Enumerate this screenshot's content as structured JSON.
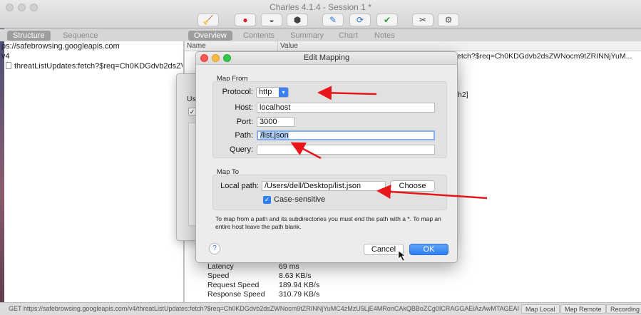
{
  "window": {
    "title": "Charles 4.1.4 - Session 1 *"
  },
  "toolbar": {
    "buttons": [
      {
        "name": "broom-icon",
        "glyph": "🧹",
        "color": "#d9a400"
      },
      {
        "name": "record-icon",
        "glyph": "●",
        "color": "#d0202a"
      },
      {
        "name": "throttle-icon",
        "glyph": "◒",
        "color": "#555555"
      },
      {
        "name": "breakpoint-icon",
        "glyph": "⬢",
        "color": "#444444"
      },
      {
        "name": "compose-icon",
        "glyph": "✎",
        "color": "#2f6fd6"
      },
      {
        "name": "repeat-icon",
        "glyph": "⟳",
        "color": "#2f6fd6"
      },
      {
        "name": "validate-icon",
        "glyph": "✔",
        "color": "#1e9e3a"
      },
      {
        "name": "tools-icon",
        "glyph": "✂",
        "color": "#444444"
      },
      {
        "name": "settings-icon",
        "glyph": "⚙",
        "color": "#555555"
      }
    ]
  },
  "left_tabs": {
    "structure": "Structure",
    "sequence": "Sequence"
  },
  "right_tabs": {
    "overview": "Overview",
    "contents": "Contents",
    "summary": "Summary",
    "chart": "Chart",
    "notes": "Notes"
  },
  "tree": {
    "items": [
      "ps://safebrowsing.googleapis.com",
      "v4",
      "threatListUpdates:fetch?$req=Ch0KDGdvb2dsZWNo"
    ]
  },
  "overview": {
    "col_name": "Name",
    "col_value": "Value",
    "url_value": "etch?$req=Ch0KDGdvb2dsZWNocm9tZRINNjYuM...",
    "fragment_h2": "h2]",
    "bg_fragment_us": "Us",
    "rows": [
      {
        "name": "Latency",
        "value": "69 ms"
      },
      {
        "name": "Speed",
        "value": "8.63 KB/s"
      },
      {
        "name": "Request Speed",
        "value": "189.94 KB/s"
      },
      {
        "name": "Response Speed",
        "value": "310.79 KB/s"
      }
    ]
  },
  "dialog": {
    "title": "Edit Mapping",
    "map_from_label": "Map From",
    "protocol_label": "Protocol:",
    "protocol_value": "http",
    "host_label": "Host:",
    "host_value": "localhost",
    "port_label": "Port:",
    "port_value": "3000",
    "path_label": "Path:",
    "path_value": "/list.json",
    "query_label": "Query:",
    "query_value": "",
    "map_to_label": "Map To",
    "local_path_label": "Local path:",
    "local_path_value": "/Users/dell/Desktop/list.json",
    "choose_label": "Choose",
    "case_sensitive_label": "Case-sensitive",
    "case_sensitive_checked": true,
    "note": "To map from a path and its subdirectories you must end the path with a *. To map an entire host leave the path blank.",
    "help_label": "?",
    "cancel_label": "Cancel",
    "ok_label": "OK"
  },
  "statusbar": {
    "text": "GET https://safebrowsing.googleapis.com/v4/threatListUpdates:fetch?$req=Ch0KDGdvb2dsZWNocm9tZRINNjYuMC4zMzU5LjE4MRonCAkQBBoZCg0ICRAGGAEiAzAwMTAGEAI...",
    "map_local": "Map Local",
    "map_remote": "Map Remote",
    "recording": "Recording"
  },
  "colors": {
    "accent": "#2f80f3",
    "annotation_arrow": "#e8161b"
  }
}
